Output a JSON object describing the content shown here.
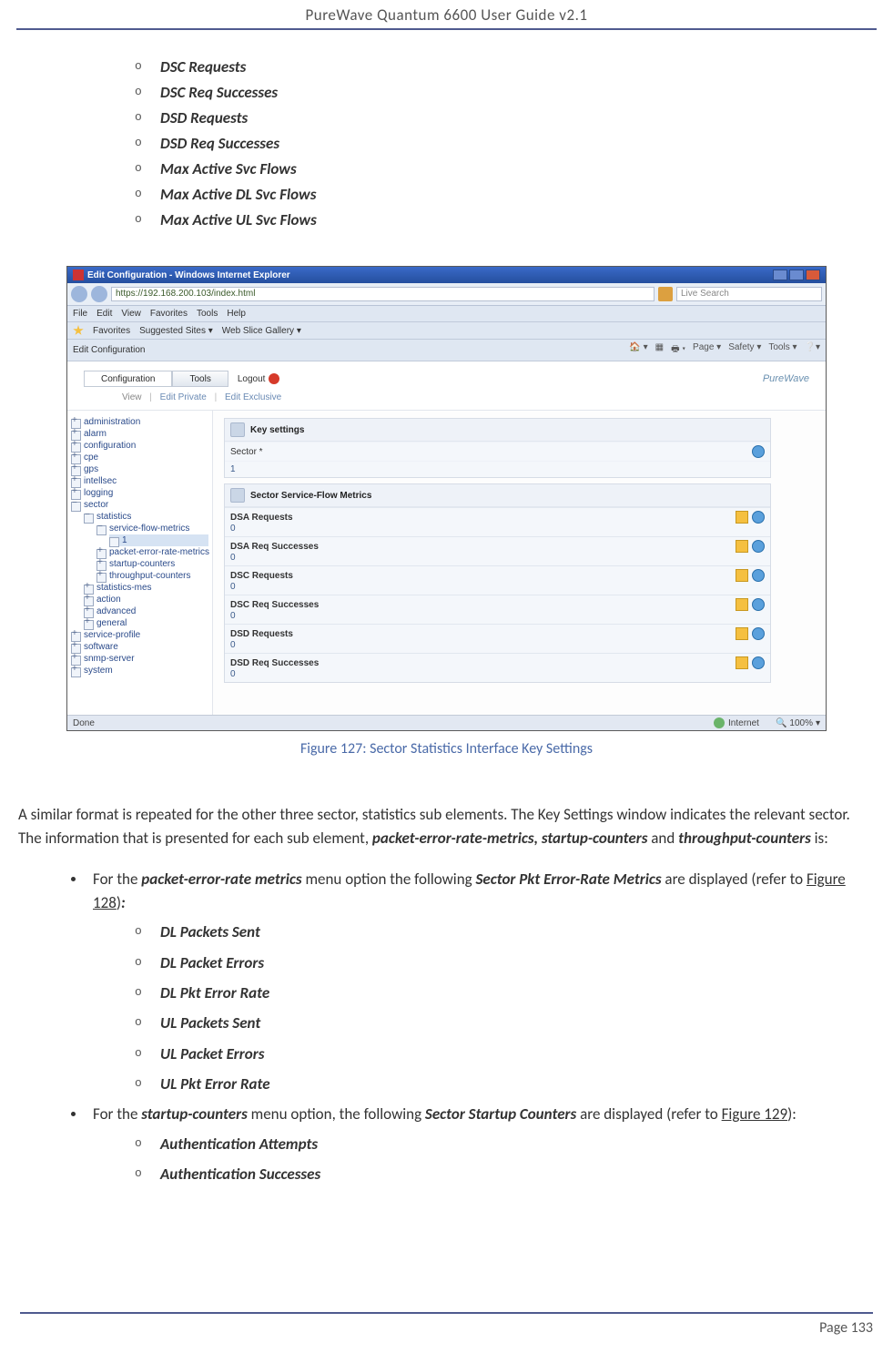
{
  "header": {
    "title": "PureWave Quantum 6600 User Guide v2.1"
  },
  "top_list": [
    "DSC Requests",
    "DSC Req Successes",
    "DSD Requests",
    "DSD Req Successes",
    "Max Active Svc Flows",
    "Max Active DL Svc Flows",
    "Max Active UL Svc Flows"
  ],
  "figure": {
    "window_title": "Edit Configuration - Windows Internet Explorer",
    "address": "https://192.168.200.103/index.html",
    "search_placeholder": "Live Search",
    "menubar": [
      "File",
      "Edit",
      "View",
      "Favorites",
      "Tools",
      "Help"
    ],
    "favbar_label": "Favorites",
    "favbar_suggested": "Suggested Sites ▾",
    "favbar_gallery": "Web Slice Gallery ▾",
    "tab_title": "Edit Configuration",
    "toolstrip": [
      "Page ▾",
      "Safety ▾",
      "Tools ▾"
    ],
    "app_tabs": {
      "configuration": "Configuration",
      "tools": "Tools",
      "logout": "Logout"
    },
    "logo": "PureWave",
    "viewrow": {
      "label": "View",
      "private": "Edit Private",
      "exclusive": "Edit Exclusive"
    },
    "tree": {
      "admin": "administration",
      "alarm": "alarm",
      "config": "configuration",
      "cpe": "cpe",
      "gps": "gps",
      "intellsec": "intellsec",
      "logging": "logging",
      "sector": "sector",
      "statistics": "statistics",
      "sfm": "service-flow-metrics",
      "one": "1",
      "pem": "packet-error-rate-metrics",
      "sc": "startup-counters",
      "tc": "throughput-counters",
      "smes": "statistics-mes",
      "action": "action",
      "advanced": "advanced",
      "general": "general",
      "sp": "service-profile",
      "software": "software",
      "snmp": "snmp-server",
      "system": "system"
    },
    "panels": {
      "keysettings_title": "Key settings",
      "sector_label": "Sector *",
      "sector_value": "1",
      "metrics_title": "Sector Service-Flow Metrics",
      "metrics": [
        {
          "label": "DSA Requests",
          "value": "0"
        },
        {
          "label": "DSA Req Successes",
          "value": "0"
        },
        {
          "label": "DSC Requests",
          "value": "0"
        },
        {
          "label": "DSC Req Successes",
          "value": "0"
        },
        {
          "label": "DSD Requests",
          "value": "0"
        },
        {
          "label": "DSD Req Successes",
          "value": "0"
        }
      ]
    },
    "status_done": "Done",
    "status_zone": "Internet",
    "status_zoom": "100%",
    "caption": "Figure 127: Sector Statistics Interface Key Settings"
  },
  "paragraph": {
    "p1a": "A similar format is repeated for the other three sector, statistics sub elements. The Key Settings window indicates the relevant sector. The information that is presented for each sub element, ",
    "p1b": "packet-error-rate-metrics, startup-counters",
    "p1c": " and ",
    "p1d": "throughput-counters",
    "p1e": " is:"
  },
  "bullet1": {
    "pre": "For the ",
    "b1": "packet-error-rate metrics",
    "mid": " menu option the following ",
    "b2": "Sector Pkt Error-Rate Metrics",
    "mid2": " are displayed (refer to ",
    "link": "Figure 128",
    "post": ")",
    "colon": ":",
    "items": [
      "DL Packets Sent",
      "DL Packet Errors",
      "DL Pkt Error Rate",
      "UL Packets Sent",
      "UL Packet Errors",
      "UL Pkt Error Rate"
    ]
  },
  "bullet2": {
    "pre": "For the ",
    "b1": "startup-counters",
    "mid": " menu option, the following ",
    "b2": "Sector Startup Counters",
    "mid2": " are displayed (refer to ",
    "link": "Figure 129",
    "post": "):",
    "items": [
      "Authentication Attempts",
      "Authentication Successes"
    ]
  },
  "footer": {
    "page": "Page 133"
  }
}
